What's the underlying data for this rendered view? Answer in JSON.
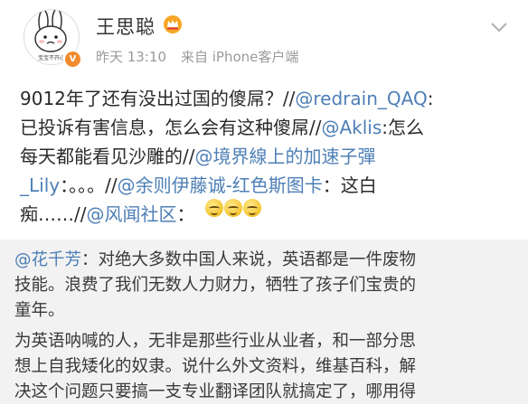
{
  "post": {
    "author": "王思聪",
    "time": "昨天 13:10",
    "source": "来自 iPhone客户端",
    "avatar_caption": "宝宝不开心",
    "lines": [
      [
        {
          "t": "9012年了还有没出过国的傻屌？//"
        },
        {
          "t": "@redrain_QAQ",
          "m": 1
        },
        {
          "t": ":"
        }
      ],
      [
        {
          "t": "已投诉有害信息，怎么会有这种傻屌//"
        },
        {
          "t": "@Aklis",
          "m": 1
        },
        {
          "t": ":怎么"
        }
      ],
      [
        {
          "t": "每天都能看见沙雕的//"
        },
        {
          "t": "@境界線上的加速子彈",
          "m": 1
        }
      ],
      [
        {
          "t": "_Lily",
          "m": 1
        },
        {
          "t": "：。。。//"
        },
        {
          "t": "@余则伊藤诚-红色斯图卡",
          "m": 1
        },
        {
          "t": "：这白"
        }
      ],
      [
        {
          "t": "痴……//"
        },
        {
          "t": "@风闻社区",
          "m": 1
        },
        {
          "t": "："
        }
      ]
    ],
    "emojis": [
      "grin-emoji",
      "grin-emoji",
      "grin-emoji"
    ]
  },
  "repost": {
    "lines": [
      [
        {
          "t": "@花千芳",
          "m": 1
        },
        {
          "t": "：对绝大多数中国人来说，英语都是一件废物"
        }
      ],
      [
        {
          "t": "技能。浪费了我们无数人力财力，牺牲了孩子们宝贵的"
        }
      ],
      [
        {
          "t": "童年。"
        }
      ],
      [
        {
          "t": "为英语呐喊的人，无非是那些行业从业者，和一部分思"
        }
      ],
      [
        {
          "t": "想上自我矮化的奴隶。说什么外文资料，维基百科，解"
        }
      ],
      [
        {
          "t": "决这个问题只要搞一支专业翻译团队就搞定了，哪用得"
        }
      ]
    ]
  },
  "colors": {
    "mention": "#4e7fb6",
    "text": "#2a2a2a",
    "meta": "#9a9a9a",
    "repost_bg": "#f2f2f2",
    "badge": "#f28b2f"
  }
}
